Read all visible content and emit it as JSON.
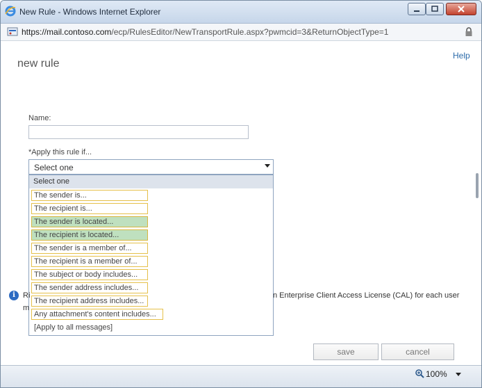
{
  "window": {
    "title": "New Rule - Windows Internet Explorer",
    "url_host": "https://mail.contoso.com",
    "url_path": "/ecp/RulesEditor/NewTransportRule.aspx?pwmcid=3&ReturnObjectType=1"
  },
  "page": {
    "help": "Help",
    "title": "new rule",
    "name_label": "Name:",
    "name_value": "",
    "apply_label": "*Apply this rule if...",
    "select_value": "Select one"
  },
  "dropdown": {
    "options": [
      "Select one",
      "The sender is...",
      "The recipient is...",
      "The sender is located...",
      "The recipient is located...",
      "The sender is a member of...",
      "The recipient is a member of...",
      "The subject or body includes...",
      "The sender address includes...",
      "The recipient address includes...",
      "Any attachment's content includes...",
      "[Apply to all messages]"
    ]
  },
  "info": {
    "left_1": "Ri",
    "left_2": "m",
    "right": "n Enterprise Client Access License (CAL) for each user"
  },
  "buttons": {
    "save": "save",
    "cancel": "cancel"
  },
  "status": {
    "zoom": "100%"
  },
  "colors": {
    "option_border": "#e5c04a",
    "option_highlight": "#bfe0bf",
    "link": "#2b6aa9"
  }
}
